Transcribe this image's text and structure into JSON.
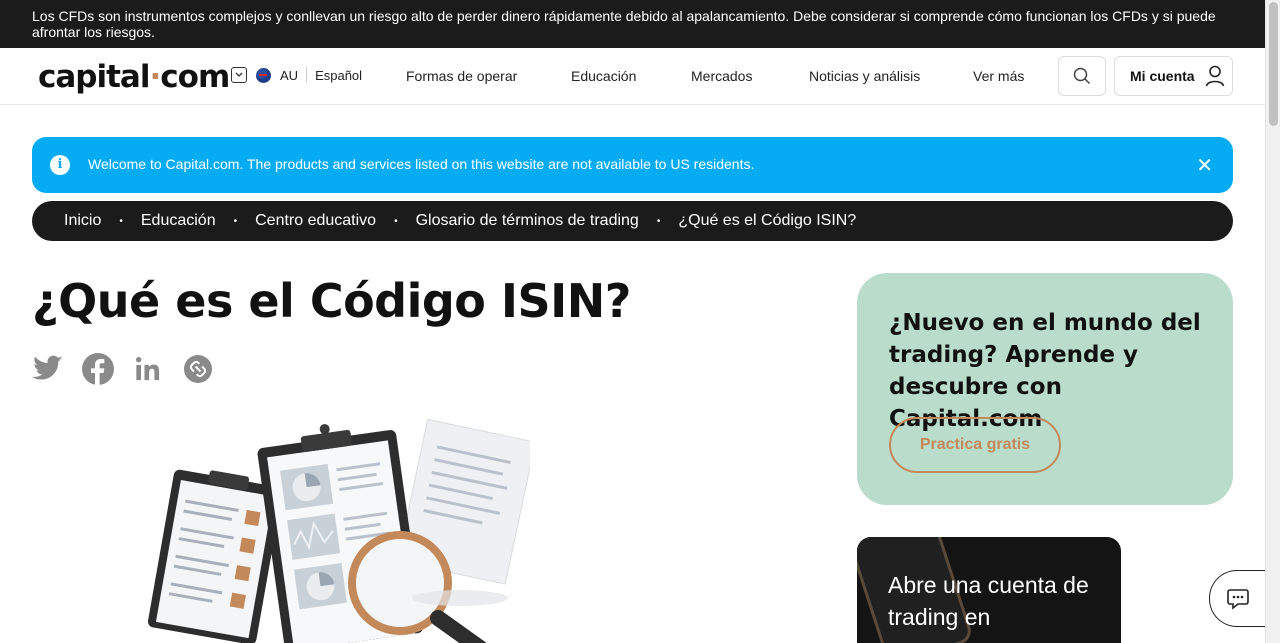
{
  "risk_warning": "Los CFDs son instrumentos complejos y conllevan un riesgo alto de perder dinero rápidamente debido al apalancamiento. Debe considerar si comprende cómo funcionan los CFDs y si puede afrontar los riesgos.",
  "header": {
    "logo_part1": "capital",
    "logo_dot": "·",
    "logo_part2": "com",
    "region": "AU",
    "language": "Español",
    "nav": [
      "Formas de operar",
      "Educación",
      "Mercados",
      "Noticias y análisis",
      "Ver más"
    ],
    "account_label": "Mi cuenta"
  },
  "notice": {
    "text": "Welcome to Capital.com. The products and services listed on this website are not available to US residents.",
    "close_label": "✕"
  },
  "breadcrumb": [
    "Inicio",
    "Educación",
    "Centro educativo",
    "Glosario de términos de trading",
    "¿Qué es el Código ISIN?"
  ],
  "breadcrumb_sep": "•",
  "article": {
    "title": "¿Qué es el Código ISIN?"
  },
  "promo": {
    "heading": "¿Nuevo en el mundo del trading? Aprende y descubre con Capital.com",
    "button": "Practica gratis"
  },
  "open_account_card": {
    "text": "Abre una cuenta de trading en"
  },
  "colors": {
    "accent": "#c4895b",
    "notice_bg": "#06acf3",
    "promo_bg": "#b9dccb",
    "dark": "#1b1b1b"
  }
}
